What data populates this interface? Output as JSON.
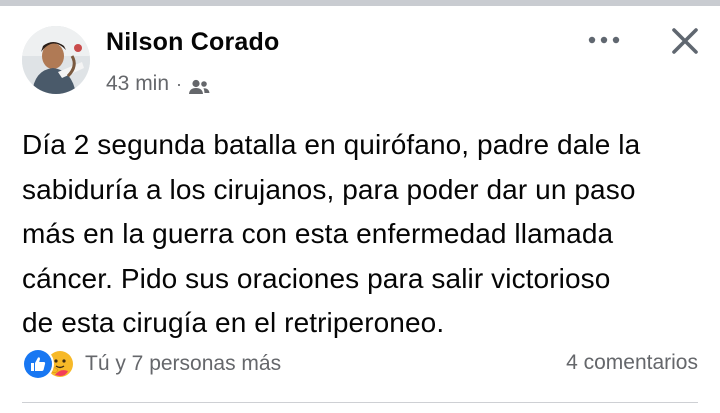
{
  "post": {
    "author": "Nilson Corado",
    "time": "43 min",
    "separator": "·",
    "audience_icon": "friends-audience-icon",
    "text_lines": [
      "Día 2 segunda batalla en quirófano, padre dale la",
      "sabiduría a los cirujanos, para poder dar un paso",
      "más en la guerra con esta enfermedad llamada",
      "cáncer. Pido sus oraciones para salir victorioso",
      "de esta cirugía en el retriperoneo."
    ]
  },
  "header_actions": {
    "more_icon": "more-horizontal-icon",
    "close_icon": "close-icon"
  },
  "engagement": {
    "reaction_icons": [
      "like-icon",
      "care-icon"
    ],
    "reactions_text": "Tú y 7 personas más",
    "comments_text": "4 comentarios"
  },
  "colors": {
    "text_primary": "#050505",
    "text_secondary": "#65676b",
    "like_blue": "#1877f2",
    "care_yellow": "#f7b928",
    "care_red": "#f33e58",
    "top_strip": "#c9ccd1"
  }
}
